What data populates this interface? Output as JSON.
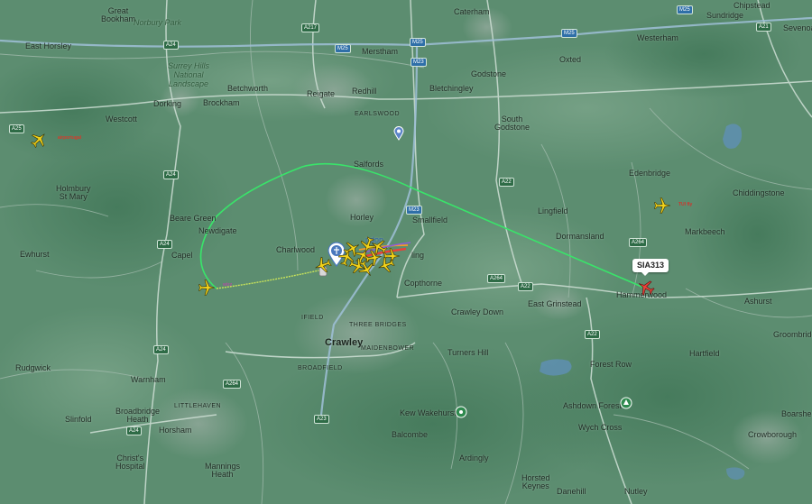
{
  "map": {
    "type": "flight-tracker-map",
    "colors": {
      "background": "#5a8c6e",
      "track": "#39e46a",
      "aircraft": "#f2d21b",
      "selected_aircraft": "#e8423a",
      "motorway_shield": "#2f6fa8",
      "a_road_shield": "#2e6b46"
    }
  },
  "callout": {
    "callsign": "SIA313"
  },
  "places": {
    "great_bookham": "Great\nBookham",
    "norbury_park": "Norbury Park",
    "caterham": "Caterham",
    "chipstead": "Chipstead",
    "sundridge": "Sundridge",
    "sevenoaks": "Sevenoaks",
    "east_horsley": "East Horsley",
    "surrey_hills": "Surrey Hills\nNational\nLandscape",
    "merstham": "Merstham",
    "westerham": "Westerham",
    "oxted": "Oxted",
    "godstone": "Godstone",
    "betchworth": "Betchworth",
    "reigate": "Reigate",
    "redhill": "Redhill",
    "bletchingley": "Bletchingley",
    "dorking": "Dorking",
    "brockham": "Brockham",
    "earlswood": "EARLSWOOD",
    "westcott": "Westcott",
    "south_godstone": "South\nGodstone",
    "salfords": "Salfords",
    "edenbridge": "Edenbridge",
    "holmbury": "Holmbury\nSt Mary",
    "chiddingstone": "Chiddingstone",
    "horley": "Horley",
    "smallfield": "Smallfield",
    "lingfield": "Lingfield",
    "beare_green": "Beare Green",
    "newdigate": "Newdigate",
    "markbeech": "Markbeech",
    "dormansland": "Dormansland",
    "charlwood": "Charlwood",
    "ewhurst": "Ewhurst",
    "capel": "Capel",
    "burstow": "ling",
    "copthorne": "Copthorne",
    "hammerwood": "Hammerwood",
    "east_grinstead": "East Grinstead",
    "ashurst": "Ashurst",
    "ifield": "IFIELD",
    "three_bridges": "THREE BRIDGES",
    "crawley_down": "Crawley Down",
    "groombridge": "Groombridge",
    "crawley": "Crawley",
    "maidenbower": "MAIDENBOWER",
    "hartfield": "Hartfield",
    "turners_hill": "Turners Hill",
    "rudgwick": "Rudgwick",
    "broadfield": "BROADFIELD",
    "forest_row": "Forest Row",
    "warnham": "Warnham",
    "littlehaven": "LITTLEHAVEN",
    "ashdown_forest": "Ashdown Forest",
    "broadbridge_heath": "Broadbridge\nHeath",
    "slinfold": "Slinfold",
    "kew_wakehurst": "Kew Wakehurst",
    "wych_cross": "Wych Cross",
    "boarshead": "Boarshead",
    "horsham": "Horsham",
    "crowborough": "Crowborough",
    "balcombe": "Balcombe",
    "ardingly": "Ardingly",
    "christs_hospital": "Christ's\nHospital",
    "mannings_heath": "Mannings\nHeath",
    "horsted_keynes": "Horsted\nKeynes",
    "danehill": "Danehill",
    "nutley": "Nutley",
    "london_gatwick": "ndon"
  },
  "roads": {
    "a217": "A217",
    "m25_a": "M25",
    "m25_b": "M25",
    "m25_c": "M25",
    "m25_d": "M25",
    "a21": "A21",
    "a24_a": "A24",
    "a24_b": "A24",
    "a24_c": "A24",
    "a24_d": "A24",
    "a24_e": "A24",
    "a25": "A25",
    "m23_a": "M23",
    "m23_b": "M23",
    "a22_a": "A22",
    "a22_b": "A22",
    "a22_c": "A22",
    "a264_a": "A264",
    "a264_b": "A264",
    "a264_c": "A264",
    "a23": "A23"
  },
  "airline_labels": {
    "tap": "airportugal",
    "tui": "TUI fly",
    "wizz": "wizz"
  },
  "aircraft": [
    {
      "id": "plane-tap",
      "heading_deg": 45,
      "selected": false
    },
    {
      "id": "plane-tui",
      "heading_deg": 90,
      "selected": false
    },
    {
      "id": "plane-sia313",
      "heading_deg": 300,
      "selected": true
    },
    {
      "id": "plane-wizz",
      "heading_deg": 90,
      "selected": false
    },
    {
      "id": "plane-gatwick-1",
      "heading_deg": 250,
      "selected": false
    },
    {
      "id": "plane-gatwick-2",
      "heading_deg": 60,
      "selected": false
    },
    {
      "id": "plane-gatwick-3",
      "heading_deg": 30,
      "selected": false
    },
    {
      "id": "plane-gatwick-4",
      "heading_deg": 110,
      "selected": false
    },
    {
      "id": "plane-gatwick-5",
      "heading_deg": 200,
      "selected": false
    },
    {
      "id": "plane-gatwick-6",
      "heading_deg": 80,
      "selected": false
    },
    {
      "id": "plane-gatwick-7",
      "heading_deg": 300,
      "selected": false
    },
    {
      "id": "plane-gatwick-8",
      "heading_deg": 150,
      "selected": false
    },
    {
      "id": "plane-gatwick-9",
      "heading_deg": 20,
      "selected": false
    },
    {
      "id": "plane-gatwick-10",
      "heading_deg": 90,
      "selected": false
    },
    {
      "id": "plane-gatwick-11",
      "heading_deg": 250,
      "selected": false
    }
  ]
}
